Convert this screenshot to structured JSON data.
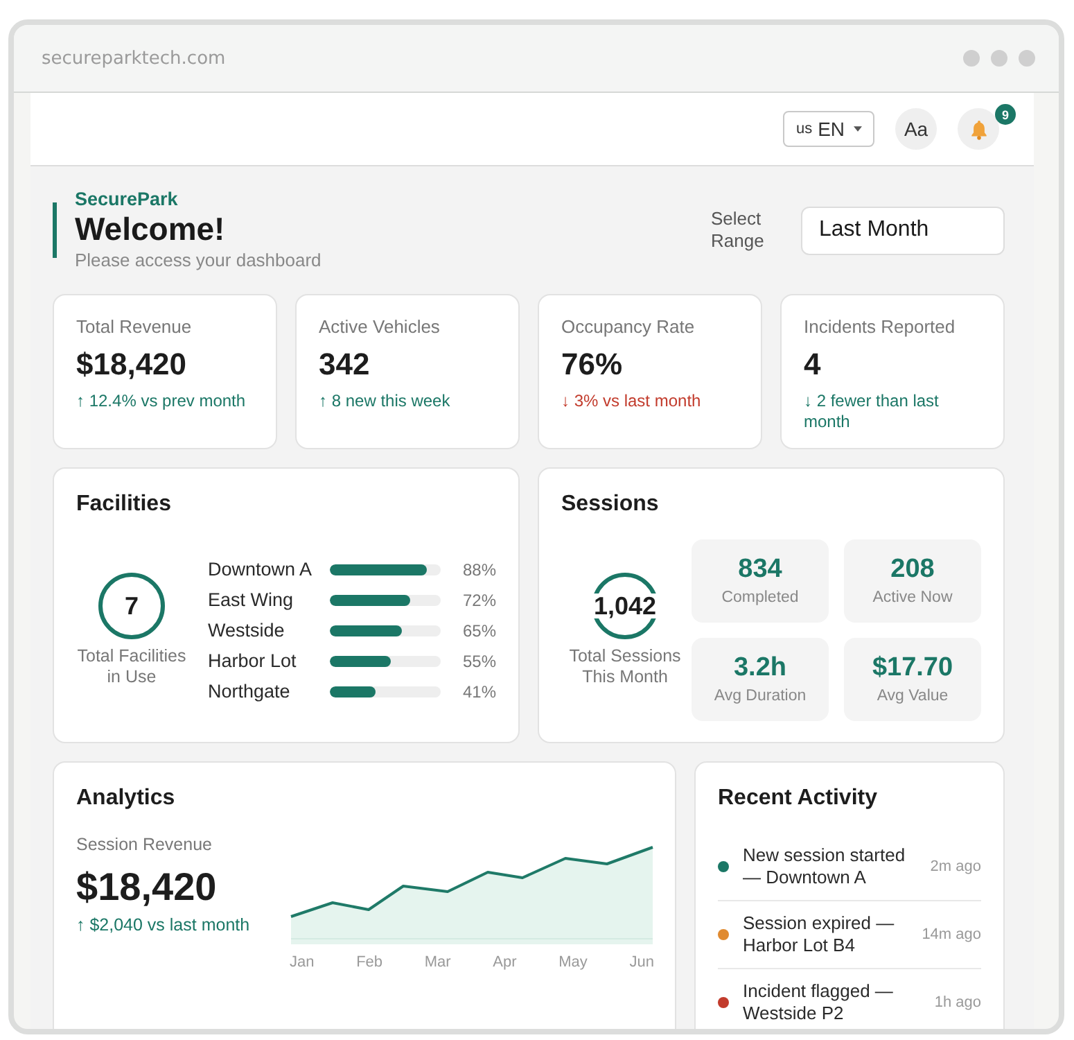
{
  "browser": {
    "url": "secureparktech.com"
  },
  "topbar": {
    "language": {
      "flag": "us",
      "code": "EN"
    },
    "font_button": "Aa",
    "notifications": {
      "count": "9"
    }
  },
  "header": {
    "brand": "SecurePark",
    "title": "Welcome!",
    "subtitle": "Please access your dashboard",
    "range": {
      "label": "Select Range",
      "value": "Last Month"
    }
  },
  "kpis": [
    {
      "label": "Total Revenue",
      "value": "$18,420",
      "delta": "↑ 12.4% vs prev month",
      "negative": false
    },
    {
      "label": "Active Vehicles",
      "value": "342",
      "delta": "↑ 8 new this week",
      "negative": false
    },
    {
      "label": "Occupancy Rate",
      "value": "76%",
      "delta": "↓ 3% vs last month",
      "negative": true
    },
    {
      "label": "Incidents Reported",
      "value": "4",
      "delta": "↓ 2 fewer than last month",
      "negative": false
    }
  ],
  "facilities": {
    "title": "Facilities",
    "total": "7",
    "total_label": "Total Facilities in Use",
    "items": [
      {
        "name": "Downtown A",
        "level": 0.88,
        "reading": "88%"
      },
      {
        "name": "East Wing",
        "level": 0.72,
        "reading": "72%"
      },
      {
        "name": "Westside",
        "level": 0.65,
        "reading": "65%"
      },
      {
        "name": "Harbor Lot",
        "level": 0.55,
        "reading": "55%"
      },
      {
        "name": "Northgate",
        "level": 0.41,
        "reading": "41%"
      }
    ]
  },
  "sessions": {
    "title": "Sessions",
    "total": "1,042",
    "total_label": "Total Sessions This Month",
    "stats": [
      {
        "value": "834",
        "label": "Completed"
      },
      {
        "value": "208",
        "label": "Active Now"
      },
      {
        "value": "3.2h",
        "label": "Avg Duration"
      },
      {
        "value": "$17.70",
        "label": "Avg Value"
      }
    ]
  },
  "analytics": {
    "title": "Analytics",
    "metric_label": "Session Revenue",
    "value": "$18,420",
    "delta": "↑ $2,040 vs last month",
    "negative": false,
    "months": [
      "Jan",
      "Feb",
      "Mar",
      "Apr",
      "May",
      "Jun"
    ]
  },
  "recent_activity": {
    "title": "Recent Activity",
    "items": [
      {
        "text": "New session started — Downtown A",
        "time": "2m ago",
        "color": "#1b7766"
      },
      {
        "text": "Session expired — Harbor Lot B4",
        "time": "14m ago",
        "color": "#e08a30"
      },
      {
        "text": "Incident flagged — Westside P2",
        "time": "1h ago",
        "color": "#c23b2c"
      }
    ]
  }
}
